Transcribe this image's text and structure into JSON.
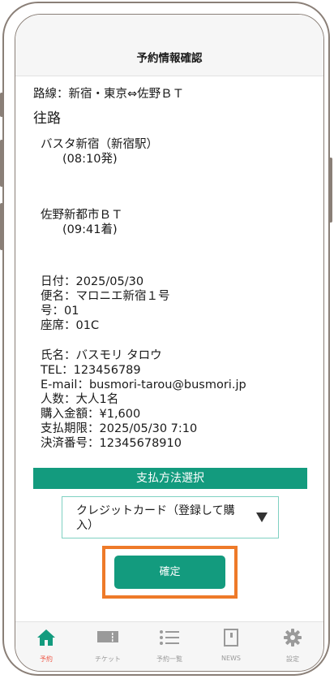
{
  "header": {
    "title": "予約情報確認"
  },
  "route": "路線：新宿・東京⇔佐野ＢＴ",
  "section": "往路",
  "departure": {
    "stop": "バスタ新宿（新宿駅）",
    "time": "(08:10発)"
  },
  "arrival": {
    "stop": "佐野新都市ＢＴ",
    "time": "(09:41着)"
  },
  "trip": {
    "date": "日付：2025/05/30",
    "bus": "便名：マロニエ新宿１号",
    "car": "号：01",
    "seat": "座席：01C"
  },
  "customer": {
    "name": "氏名：バスモリ タロウ",
    "tel": "TEL：123456789",
    "email": "E-mail：busmori-tarou@busmori.jp",
    "people": "人数：大人1名",
    "amount": "購入金額：¥1,600",
    "deadline": "支払期限：2025/05/30 7:10",
    "payment_no": "決済番号：12345678910"
  },
  "payment": {
    "header": "支払方法選択",
    "selected": "クレジットカード（登録して購入）"
  },
  "confirm_label": "確定",
  "tabs": [
    {
      "label": "予約",
      "icon": "home-icon",
      "active": true
    },
    {
      "label": "チケット",
      "icon": "ticket-icon",
      "active": false
    },
    {
      "label": "予約一覧",
      "icon": "list-icon",
      "active": false
    },
    {
      "label": "NEWS",
      "icon": "news-icon",
      "active": false
    },
    {
      "label": "設定",
      "icon": "gear-icon",
      "active": false
    }
  ],
  "colors": {
    "accent": "#139b7e",
    "highlight": "#ee7a29",
    "active_tab": "#ee5a4a"
  }
}
